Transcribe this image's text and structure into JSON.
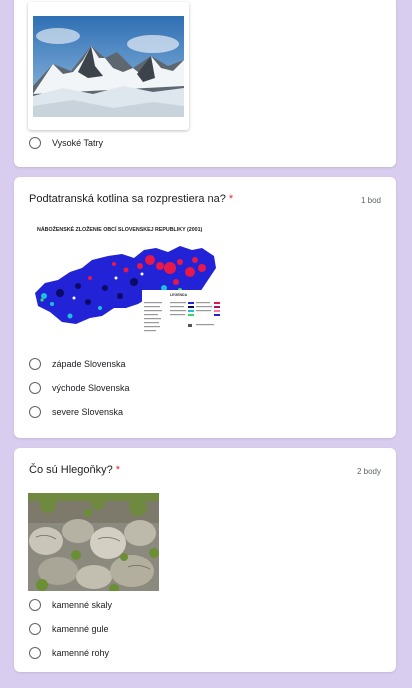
{
  "question1": {
    "options": [
      {
        "label": "Vysoké Tatry"
      }
    ]
  },
  "question2": {
    "title": "Podtatranská kotlina sa rozprestiera na?",
    "required_mark": "*",
    "points": "1 bod",
    "map": {
      "title": "NÁBOŽENSKÉ ZLOŽENIE OBCÍ SLOVENSKEJ REPUBLIKY (2001)",
      "legend_title": "LEGENDA"
    },
    "options": [
      {
        "label": "západe Slovenska"
      },
      {
        "label": "východe Slovenska"
      },
      {
        "label": "severe Slovenska"
      }
    ]
  },
  "question3": {
    "title": "Čo sú Hlegoňky?",
    "required_mark": "*",
    "points": "2 body",
    "options": [
      {
        "label": "kamenné skaly"
      },
      {
        "label": "kamenné gule"
      },
      {
        "label": "kamenné rohy"
      }
    ]
  }
}
